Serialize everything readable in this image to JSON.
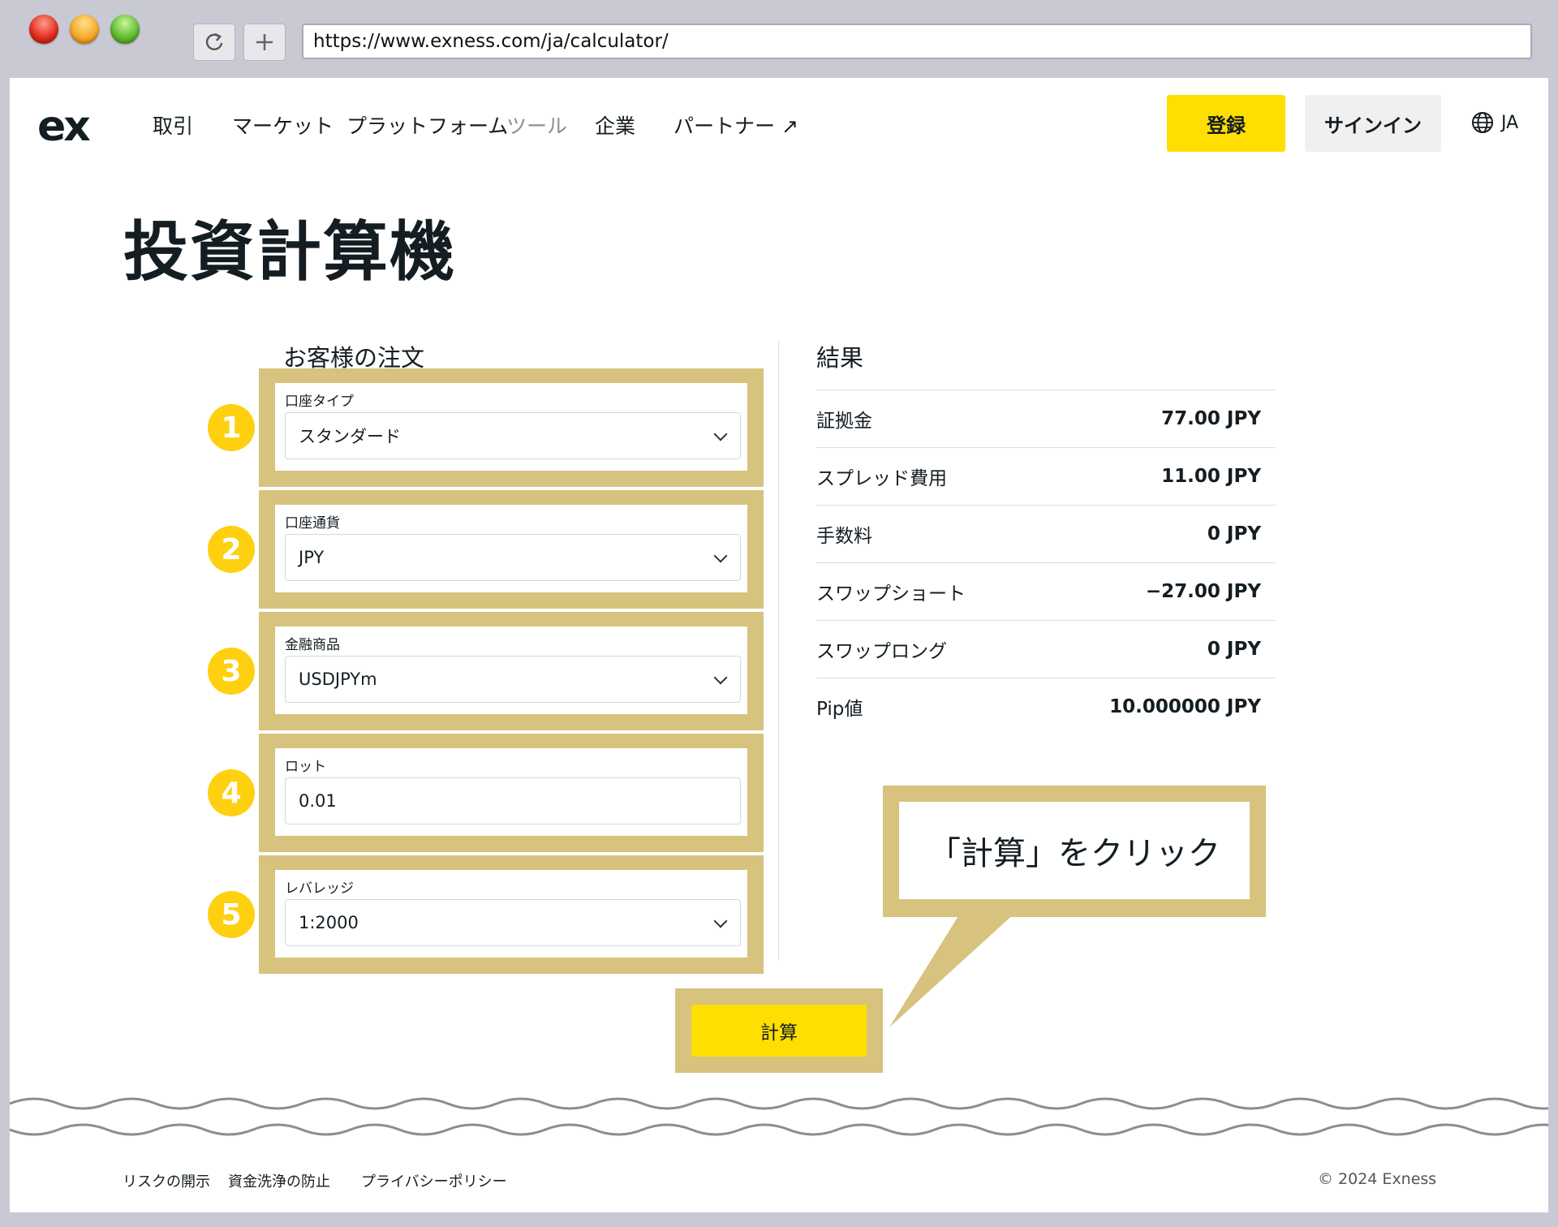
{
  "browser": {
    "url": "https://www.exness.com/ja/calculator/",
    "reload_icon": "reload-icon",
    "new_tab_icon": "plus-icon"
  },
  "header": {
    "logo": "ex",
    "nav": [
      "取引",
      "マーケット",
      "プラットフォーム",
      "ツール",
      "企業",
      "パートナー ↗"
    ],
    "active_nav": "ツール",
    "register": "登録",
    "signin": "サインイン",
    "lang": "JA"
  },
  "main": {
    "title": "投資計算機",
    "order_title": "お客様の注文",
    "result_title": "結果",
    "fields": [
      {
        "badge": "1",
        "label": "口座タイプ",
        "value": "スタンダード",
        "type": "select"
      },
      {
        "badge": "2",
        "label": "口座通貨",
        "value": "JPY",
        "type": "select"
      },
      {
        "badge": "3",
        "label": "金融商品",
        "value": "USDJPYm",
        "type": "select"
      },
      {
        "badge": "4",
        "label": "ロット",
        "value": "0.01",
        "type": "input"
      },
      {
        "badge": "5",
        "label": "レバレッジ",
        "value": "1:2000",
        "type": "select"
      }
    ],
    "results": [
      {
        "label": "証拠金",
        "value": "77.00 JPY"
      },
      {
        "label": "スプレッド費用",
        "value": "11.00 JPY"
      },
      {
        "label": "手数料",
        "value": "0 JPY"
      },
      {
        "label": "スワップショート",
        "value": "−27.00 JPY"
      },
      {
        "label": "スワップロング",
        "value": "0 JPY"
      },
      {
        "label": "Pip値",
        "value": "10.000000 JPY"
      }
    ],
    "callout": "「計算」をクリック",
    "calculate": "計算"
  },
  "footer": {
    "links": [
      "リスクの開示",
      "資金洗浄の防止",
      "プライバシーポリシー"
    ],
    "copyright": "© 2024 Exness"
  },
  "colors": {
    "accent_yellow": "#ffde02",
    "annotation_gold": "#d7c27e",
    "badge_yellow": "#ffd010"
  }
}
